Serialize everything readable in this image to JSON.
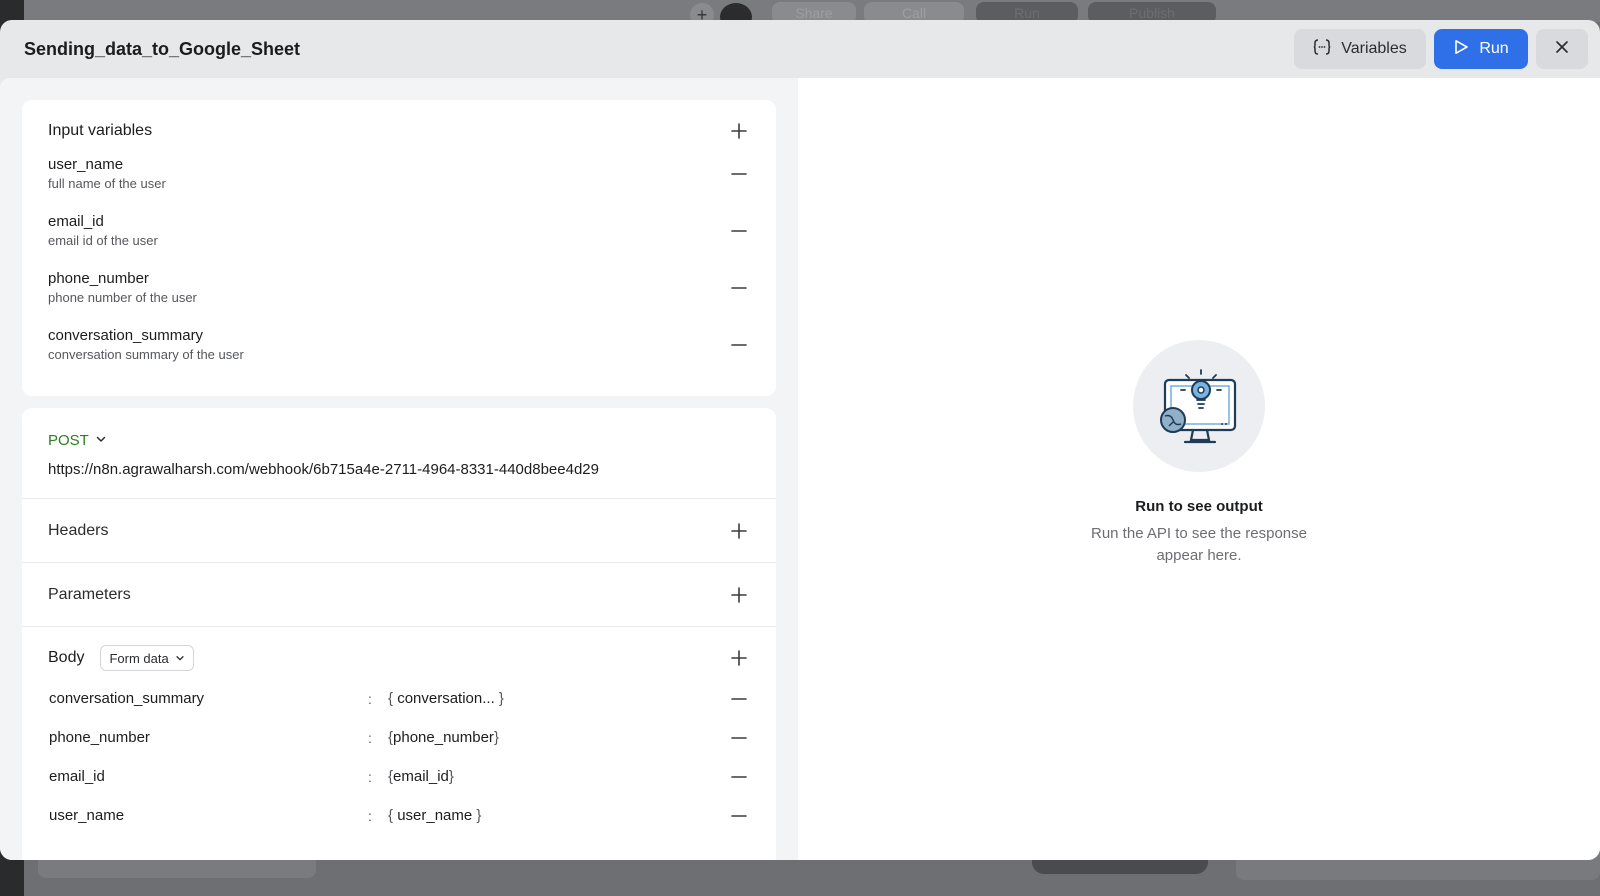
{
  "background": {
    "share_label": "Share",
    "call_label": "Call",
    "run_label": "Run",
    "publish_label": "Publish"
  },
  "modal": {
    "title": "Sending_data_to_Google_Sheet",
    "variables_label": "Variables",
    "run_label": "Run"
  },
  "input_variables": {
    "label": "Input variables",
    "items": [
      {
        "name": "user_name",
        "description": "full name of the user"
      },
      {
        "name": "email_id",
        "description": "email id of the user"
      },
      {
        "name": "phone_number",
        "description": "phone number of the user"
      },
      {
        "name": "conversation_summary",
        "description": "conversation summary of the user"
      }
    ]
  },
  "request": {
    "method": "POST",
    "url": "https://n8n.agrawalharsh.com/webhook/6b715a4e-2711-4964-8331-440d8bee4d29",
    "headers_label": "Headers",
    "parameters_label": "Parameters",
    "body_label": "Body",
    "body_type": "Form data",
    "body_rows": [
      {
        "key": "conversation_summary",
        "separator": ":",
        "value": "conversation..."
      },
      {
        "key": "phone_number",
        "separator": ":",
        "value": "phone_number"
      },
      {
        "key": "email_id",
        "separator": ":",
        "value": "email_id"
      },
      {
        "key": "user_name",
        "separator": ":",
        "value": "user_name"
      }
    ]
  },
  "output": {
    "title": "Run to see output",
    "subtitle": "Run the API to see the response appear here."
  },
  "colors": {
    "accent": "#2f6fe8",
    "method_green": "#2f7d1f"
  }
}
